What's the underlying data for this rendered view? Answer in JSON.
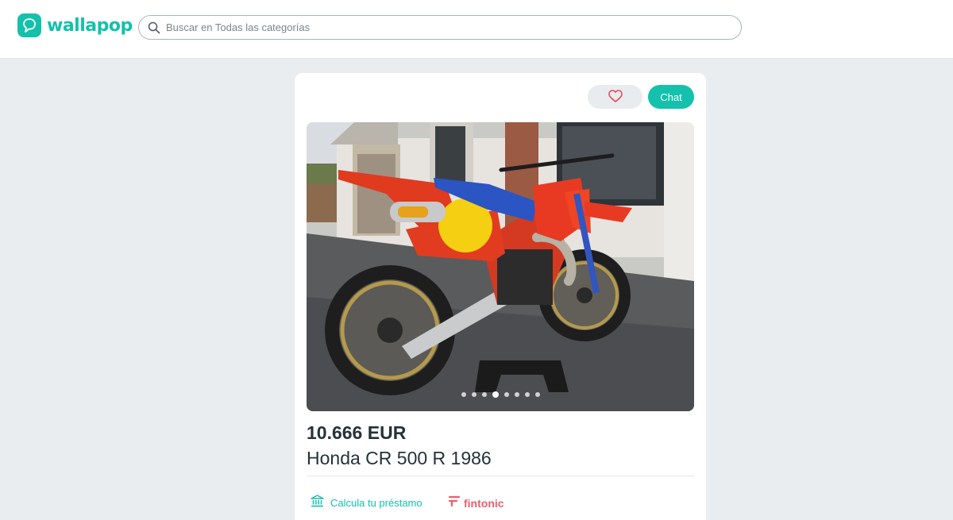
{
  "header": {
    "logo_text": "wallapop",
    "search_placeholder": "Buscar en Todas las categorías"
  },
  "listing": {
    "price": "10.666 EUR",
    "title": "Honda CR 500 R 1986",
    "chat_label": "Chat",
    "favorite_icon": "heart-icon",
    "photo_count": 8,
    "active_photo": 4
  },
  "financing": {
    "loan_label": "Calcula tu préstamo",
    "loan_icon": "bank-icon",
    "partner_name": "fintonic"
  },
  "colors": {
    "brand": "#13c1ac",
    "heart": "#e5485d",
    "fintonic": "#f05b6b",
    "background": "#eaedf0"
  }
}
